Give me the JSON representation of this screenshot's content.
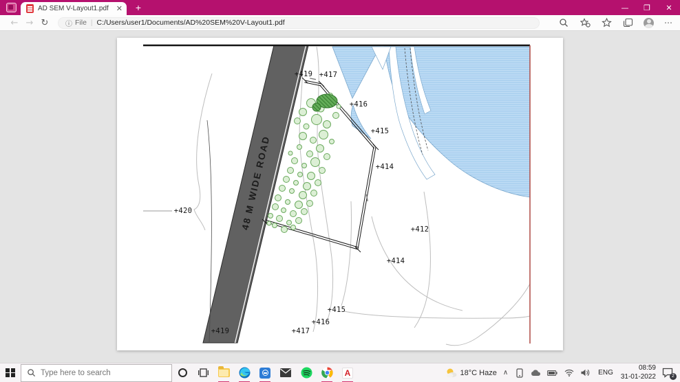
{
  "browser": {
    "tab_title": "AD SEM V-Layout1.pdf",
    "address": {
      "scheme_label": "File",
      "url": "C:/Users/user1/Documents/AD%20SEM%20V-Layout1.pdf"
    }
  },
  "pdf": {
    "road_label": "48 M WIDE ROAD",
    "labels": [
      "+419",
      "+417",
      "+416",
      "+415",
      "+414",
      "+420",
      "+412",
      "+414",
      "+415",
      "+416",
      "+417",
      "+419"
    ]
  },
  "taskbar": {
    "search_placeholder": "Type here to search",
    "weather_temp": "18°C",
    "weather_cond": "Haze",
    "language": "ENG",
    "time": "08:59",
    "date": "31-01-2022",
    "notification_count": "2"
  }
}
